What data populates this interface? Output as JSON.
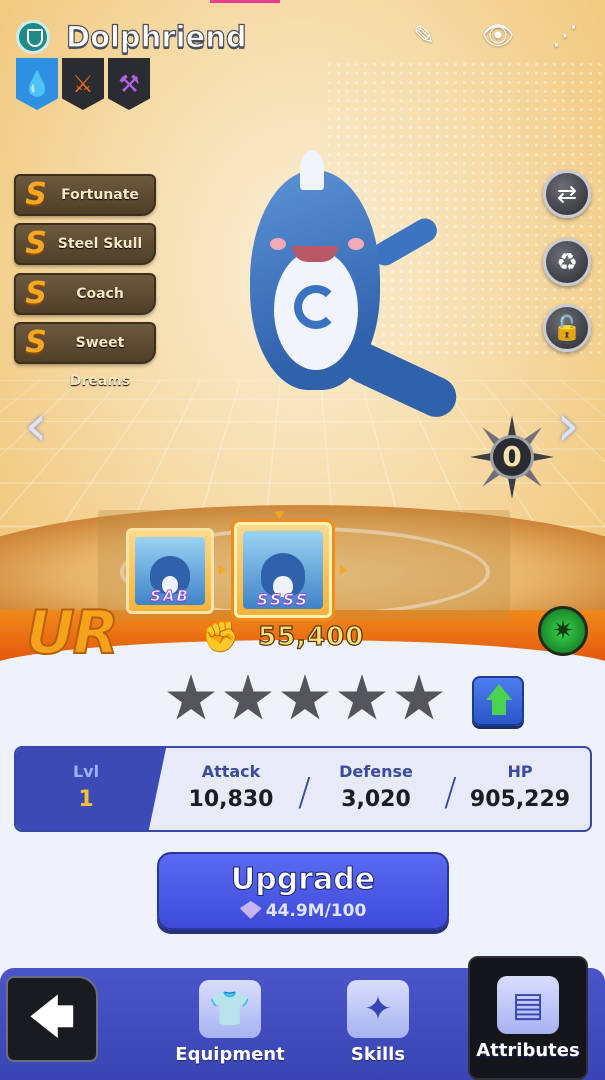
{
  "header": {
    "title": "Dolphriend",
    "edit_icon": "edit-note-icon",
    "view_icon": "eye-icon",
    "share_icon": "share-icon"
  },
  "elements": [
    {
      "name": "water-drop-icon",
      "glyph": "💧",
      "color": "#2f8fe0"
    },
    {
      "name": "crossed-swords-icon",
      "glyph": "⚔",
      "color": "#2b2c31"
    },
    {
      "name": "axe-icon",
      "glyph": "🪓",
      "color": "#2b2c31"
    }
  ],
  "traits": [
    {
      "grade": "S",
      "label": "Fortunate"
    },
    {
      "grade": "S",
      "label": "Steel Skull"
    },
    {
      "grade": "S",
      "label": "Coach"
    },
    {
      "grade": "S",
      "label": "Sweet Dreams"
    }
  ],
  "side_buttons": [
    {
      "name": "swap-icon",
      "glyph": "⇄"
    },
    {
      "name": "recycle-icon",
      "glyph": "♻"
    },
    {
      "name": "lock-icon",
      "glyph": "🔓"
    }
  ],
  "nav": {
    "left": "‹",
    "right": "›"
  },
  "compass_value": "0",
  "evolution": [
    {
      "grade": "SAB",
      "active": false
    },
    {
      "grade": "SSSS",
      "active": true
    }
  ],
  "rarity": "UR",
  "power": "55,400",
  "stars": {
    "filled": 0,
    "total": 5
  },
  "stats": {
    "lvl_label": "Lvl",
    "lvl_value": "1",
    "attack_label": "Attack",
    "attack_value": "10,830",
    "defense_label": "Defense",
    "defense_value": "3,020",
    "hp_label": "HP",
    "hp_value": "905,229"
  },
  "upgrade": {
    "label": "Upgrade",
    "cost": "44.9M/100"
  },
  "bottom_nav": {
    "back_glyph": "🡄",
    "items": [
      {
        "label": "Equipment",
        "glyph": "👕"
      },
      {
        "label": "Skills",
        "glyph": "✦"
      },
      {
        "label": "Attributes",
        "glyph": "▤"
      }
    ]
  }
}
